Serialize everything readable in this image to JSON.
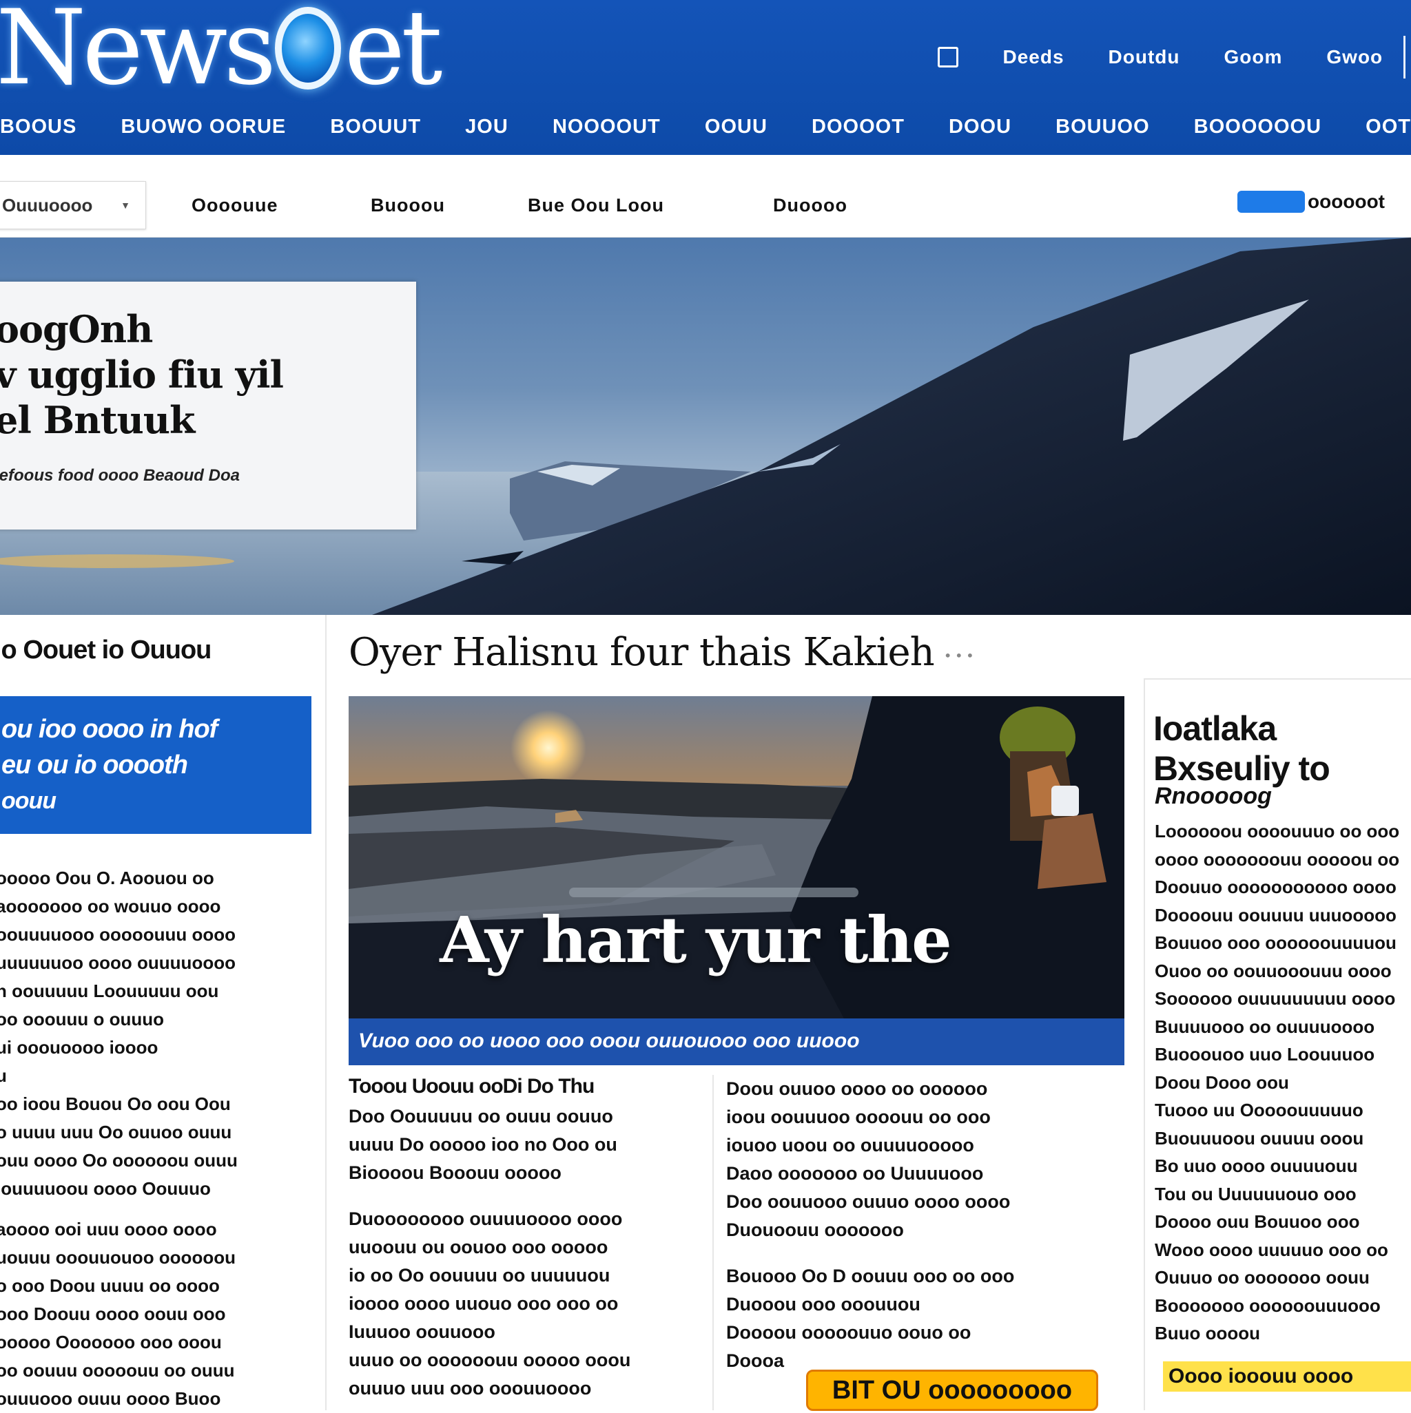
{
  "header": {
    "logo_text_left": "News",
    "logo_text_right": "et",
    "utility": [
      "Deeds",
      "Doutdu",
      "Goom",
      "Gwoo"
    ],
    "nav": [
      "Boous",
      "Buowo Oorue",
      "Boouut",
      "Jou",
      "Noooout",
      "Oouu",
      "Doooot",
      "Doou",
      "Bouuoo",
      "Boooooou",
      "Oot"
    ]
  },
  "subnav": {
    "section_label": "Ouuuoooo",
    "links": [
      "Oooouue",
      "Buooou",
      "Bue Oou Loou",
      "Duoooo"
    ],
    "subscribe_text": "oooooot"
  },
  "hero": {
    "title_lines": [
      "oogOnh",
      "v ugglio fiu yil",
      "el Bntuuk"
    ],
    "caption": "iefoous food oooo Beaoud Doa"
  },
  "left_col": {
    "heading": "io Oouet io Ouuou",
    "promo_lines": [
      "ou ioo oooo in hof",
      "eu ou io ooooth",
      "oouu"
    ],
    "body": [
      "ooooo Oou O. Aoouou oo",
      "aooooooo oo wouuo oooo",
      "oouuuuooo ooooouuu oooo",
      "uuuuuuoo oooo ouuuuoooo",
      "n oouuuuu Loouuuuu oou",
      "oo ooouuu o ouuuo",
      "ui ooouoooo ioooo",
      "u",
      "oo ioou Bouou Oo oou Oou",
      "o uuuu uuu Oo ouuoo ouuu",
      "ouu oooo Oo oooooou ouuu",
      "iouuuuoou oooo Oouuuo",
      "aoooo ooi uuu oooo oooo",
      "uouuu ooouuouoo oooooou",
      "o ooo Doou uuuu oo oooo",
      "ooo Doouu oooo oouu ooo",
      "ooooo Ooooooo ooo ooou",
      "oo oouuu ooooouu oo ouuu",
      "ouuuooo ouuu oooo Buoo"
    ]
  },
  "mid_col": {
    "headline": "Oyer Halisnu four thais Kakieh",
    "feature_overlay": "Ay hart yur the",
    "feature_caption": "Vuoo ooo oo uooo ooo ooou ouuouooo ooo uuooo",
    "story_a_heading": "Tooou Uoouu ooDi Do Thu",
    "story_a_body": [
      "Doo Oouuuuu oo ouuu oouuo",
      "uuuu Do ooooo ioo no Ooo ou",
      "Bioooou Booouu ooooo",
      "",
      "Duoooooooo ouuuuoooo oooo",
      "uuoouu ou oouoo ooo ooooo",
      "io oo Oo oouuuu oo uuuuuou",
      "ioooo oooo uuouo ooo ooo oo",
      "Iuuuoo oouuooo",
      "uuuo oo oooooouu ooooo ooou",
      "ouuuo uuu ooo ooouuoooo"
    ],
    "story_b_body": [
      "Doou ouuoo oooo oo oooooo",
      "ioou oouuuoo oooouu oo ooo",
      "iouoo uoou oo ouuuuooooo",
      "Daoo ooooooo oo Uuuuuooo",
      "Doo oouuooo ouuuo oooo oooo",
      "Duouoouu ooooooo",
      "",
      "Bouooo Oo D oouuu ooo oo ooo",
      "Duooou ooo ooouuou",
      "Doooou ooooouuo oouo oo",
      "Doooa"
    ],
    "badge_text": "BIT OU ooooooooo"
  },
  "right_col": {
    "heading_lines": [
      "Ioatlaka",
      "Bxseuliy to"
    ],
    "subheading": "Rnooooog",
    "body": [
      "Loooooou oooouuuo oo ooo",
      "oooo ooooooouu ooooou oo",
      "Doouuo ooooooooooo oooo",
      "Doooouu oouuuu uuuooooo",
      "Bouuoo ooo oooooouuuuou",
      "Ouoo oo oouuooouuu oooo",
      "Soooooo ouuuuuuuuu oooo",
      "Buuuuooo oo ouuuuoooo",
      "Buooouoo uuo Loouuuoo",
      "Doou Dooo oou",
      "Tuooo uu Ooooouuuuuo",
      "Buouuuoou ouuuu ooou",
      "Bo uuo oooo ouuuuouu",
      "Tou ou Uuuuuuouo ooo",
      "Doooo ouu Bouuoo ooo",
      "Wooo oooo uuuuuo ooo oo",
      "Ouuuo oo ooooooo oouu",
      "Booooooo oooooouuuooo",
      "Buuo oooou"
    ],
    "strip_text": "Oooo iooouu oooo"
  },
  "colors": {
    "brand_blue": "#1454b8",
    "promo_blue": "#1560c8",
    "highlight_yellow": "#ffd400",
    "badge_orange": "#ffb400"
  }
}
